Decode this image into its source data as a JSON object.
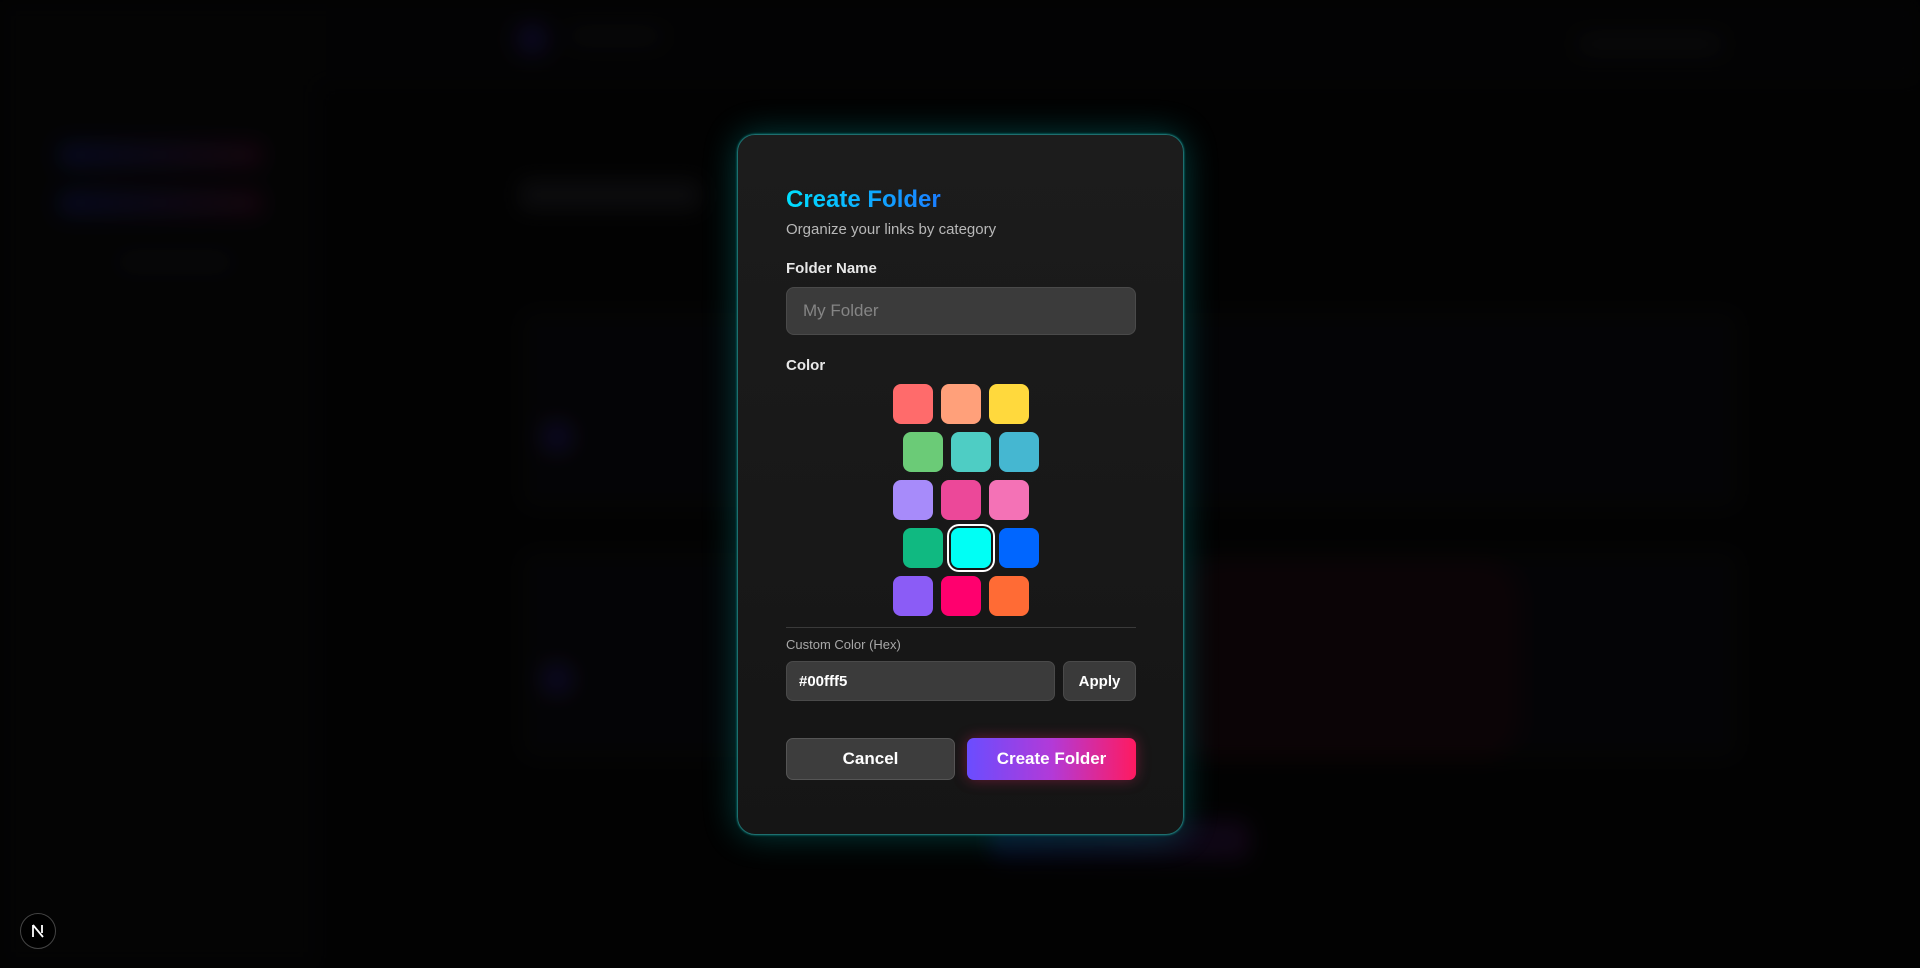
{
  "modal": {
    "title": "Create Folder",
    "subtitle": "Organize your links by category",
    "name_label": "Folder Name",
    "name_placeholder": "My Folder",
    "name_value": "",
    "color_label": "Color",
    "swatch_colors": [
      "#ff6b6b",
      "#ffa07a",
      "#ffd93d",
      "#6bcb77",
      "#4ecdc4",
      "#45b7d1",
      "#a78bfa",
      "#ec4899",
      "#f472b6",
      "#10b981",
      "#00fff5",
      "#0066ff",
      "#8b5cf6",
      "#ff006e",
      "#ff6b35"
    ],
    "selected_color": "#00fff5",
    "custom_hex_label": "Custom Color (Hex)",
    "custom_hex_value": "#00fff5",
    "apply_label": "Apply",
    "cancel_label": "Cancel",
    "create_label": "Create Folder"
  },
  "colors": {
    "title_gradient_start": "#00e0ff",
    "title_gradient_end": "#1a7dff",
    "modal_border_glow": "#00fff5",
    "create_gradient_start": "#6a4dff",
    "create_gradient_end": "#ff1a60"
  },
  "badge": {
    "icon": "nextjs-logo-icon"
  }
}
